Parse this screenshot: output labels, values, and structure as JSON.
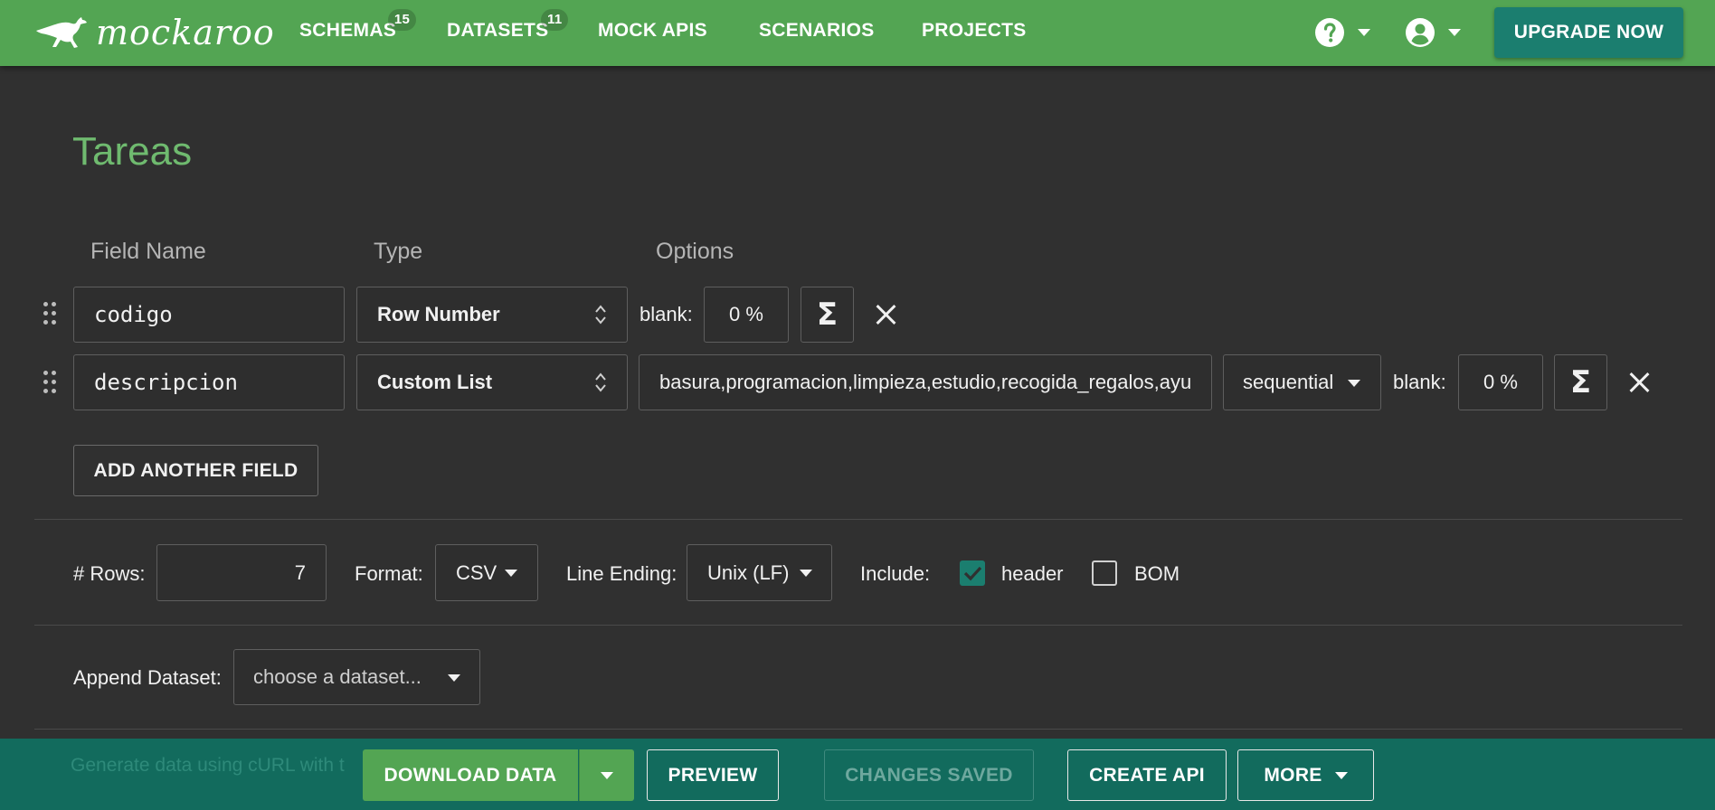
{
  "nav": {
    "logo_text": "mockaroo",
    "items": [
      {
        "label": "SCHEMAS",
        "badge": "15"
      },
      {
        "label": "DATASETS",
        "badge": "11"
      },
      {
        "label": "MOCK APIS"
      },
      {
        "label": "SCENARIOS"
      },
      {
        "label": "PROJECTS"
      }
    ],
    "help_icon": "help-circle-icon",
    "account_icon": "account-circle-icon",
    "upgrade_label": "UPGRADE NOW"
  },
  "schema": {
    "title": "Tareas",
    "columns": {
      "field_name": "Field Name",
      "type": "Type",
      "options": "Options"
    },
    "fields": [
      {
        "name": "codigo",
        "type": "Row Number",
        "blank_label": "blank:",
        "blank_value": "0 %"
      },
      {
        "name": "descripcion",
        "type": "Custom List",
        "values": "basura,programacion,limpieza,estudio,recogida_regalos,ayu",
        "order": "sequential",
        "blank_label": "blank:",
        "blank_value": "0 %"
      }
    ],
    "sigma_glyph": "Σ",
    "add_field_label": "ADD ANOTHER FIELD"
  },
  "options": {
    "rows_label": "# Rows:",
    "rows_value": "7",
    "format_label": "Format:",
    "format_value": "CSV",
    "line_ending_label": "Line Ending:",
    "line_ending_value": "Unix (LF)",
    "include_label": "Include:",
    "header_label": "header",
    "header_checked": true,
    "bom_label": "BOM",
    "bom_checked": false
  },
  "append": {
    "label": "Append Dataset:",
    "placeholder": "choose a dataset..."
  },
  "bottom": {
    "curl_hint": "Generate data using cURL with t",
    "download_label": "DOWNLOAD DATA",
    "preview_label": "PREVIEW",
    "saved_label": "CHANGES SAVED",
    "create_api_label": "CREATE API",
    "more_label": "MORE"
  },
  "colors": {
    "nav_green": "#53a553",
    "title_green": "#6fba6f",
    "teal": "#126b5d",
    "check_teal": "#1b7e6f"
  }
}
